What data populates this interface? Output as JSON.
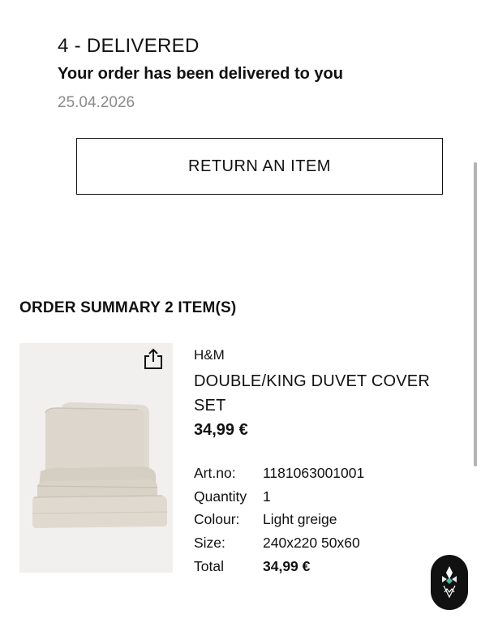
{
  "order_status": {
    "step": "4 - DELIVERED",
    "message": "Your order has been delivered to you",
    "date": "25.04.2026"
  },
  "return_button": {
    "label": "RETURN AN ITEM"
  },
  "order_summary": {
    "title": "ORDER SUMMARY",
    "count": "2 ITEM(S)"
  },
  "product": {
    "brand": "H&M",
    "name": "DOUBLE/KING DUVET COVER SET",
    "price": "34,99 €",
    "image_icon": "duvet-cover-photo",
    "details": [
      {
        "label": "Art.no:",
        "value": "1181063001001"
      },
      {
        "label": "Quantity",
        "value": "1"
      },
      {
        "label": "Colour:",
        "value": "Light greige"
      },
      {
        "label": "Size:",
        "value": "240x220 50x60"
      },
      {
        "label": "Total",
        "value": "34,99 €"
      }
    ]
  },
  "icons": {
    "share": "share-icon",
    "assistant": "assistant-logo-icon"
  },
  "colors": {
    "text": "#111111",
    "muted": "#8a8a8a",
    "background": "#ffffff",
    "image_bg": "#f1f0ee",
    "product_fabric": "#d9d3c9"
  }
}
